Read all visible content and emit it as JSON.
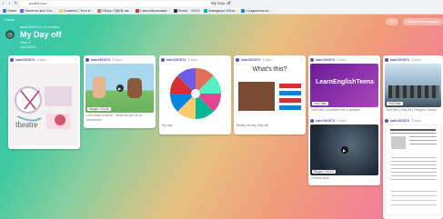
{
  "browser": {
    "tab_title": "My Day off",
    "address": "padlet.com",
    "bookmarks": [
      {
        "label": "Vifam",
        "color": "#3a7bd5"
      },
      {
        "label": "Seminar aka Gro...",
        "color": "#6c5ce7"
      },
      {
        "label": "Cxatena | Your tr...",
        "color": "#fdcb6e"
      },
      {
        "label": "ОБзор ПДКВ им...",
        "color": "#e17055"
      },
      {
        "label": "Самообразован...",
        "color": "#d63031"
      },
      {
        "label": "Home - VIGO",
        "color": "#2d3436"
      },
      {
        "label": "Заведиум Обна...",
        "color": "#00b894"
      },
      {
        "label": "Создатели по...",
        "color": "#0984e3"
      }
    ]
  },
  "padlet": {
    "label": "Padlet",
    "author": "kate2391974 • 4 months",
    "title": "My Day off",
    "subtitle": "Year 4",
    "date": "11/2/2022",
    "search_icon": "search-icon",
    "remake_label": "Переиспользовать"
  },
  "cards": [
    {
      "author": "kate2391974",
      "time": "3 days",
      "image_label": "theatre",
      "caption": "",
      "badge": ""
    },
    {
      "author": "kate2391974",
      "time": "3 days",
      "image_label": "",
      "caption": "Let's make a story! - What do you do at weekends?",
      "badge": "Skype • 03:25"
    },
    {
      "author": "kate2391974",
      "time": "3 days",
      "image_label": "",
      "caption": "My day",
      "badge": ""
    },
    {
      "author": "kate2391974",
      "time": "3 days",
      "image_label": "What's this?",
      "caption": "Ready Steady Day off!",
      "badge": ""
    },
    {
      "author": "kate2391974",
      "time": "3 days",
      "image_label": "LearnEnglishTeens",
      "caption": "YouTube • Activities with a speaker",
      "badge": "YouTube"
    },
    {
      "author": "kate2391974",
      "time": "3 days",
      "image_label": "",
      "caption": "YouTube • Day off • Penguin Games",
      "badge": "YouTube"
    },
    {
      "author": "kate2391974",
      "time": "3 days",
      "image_label": "",
      "caption": "Lexicon quiz",
      "badge": "Skype • 03:14"
    },
    {
      "author": "kate2391974",
      "time": "3 days",
      "image_label": "",
      "caption": "",
      "badge": ""
    }
  ]
}
